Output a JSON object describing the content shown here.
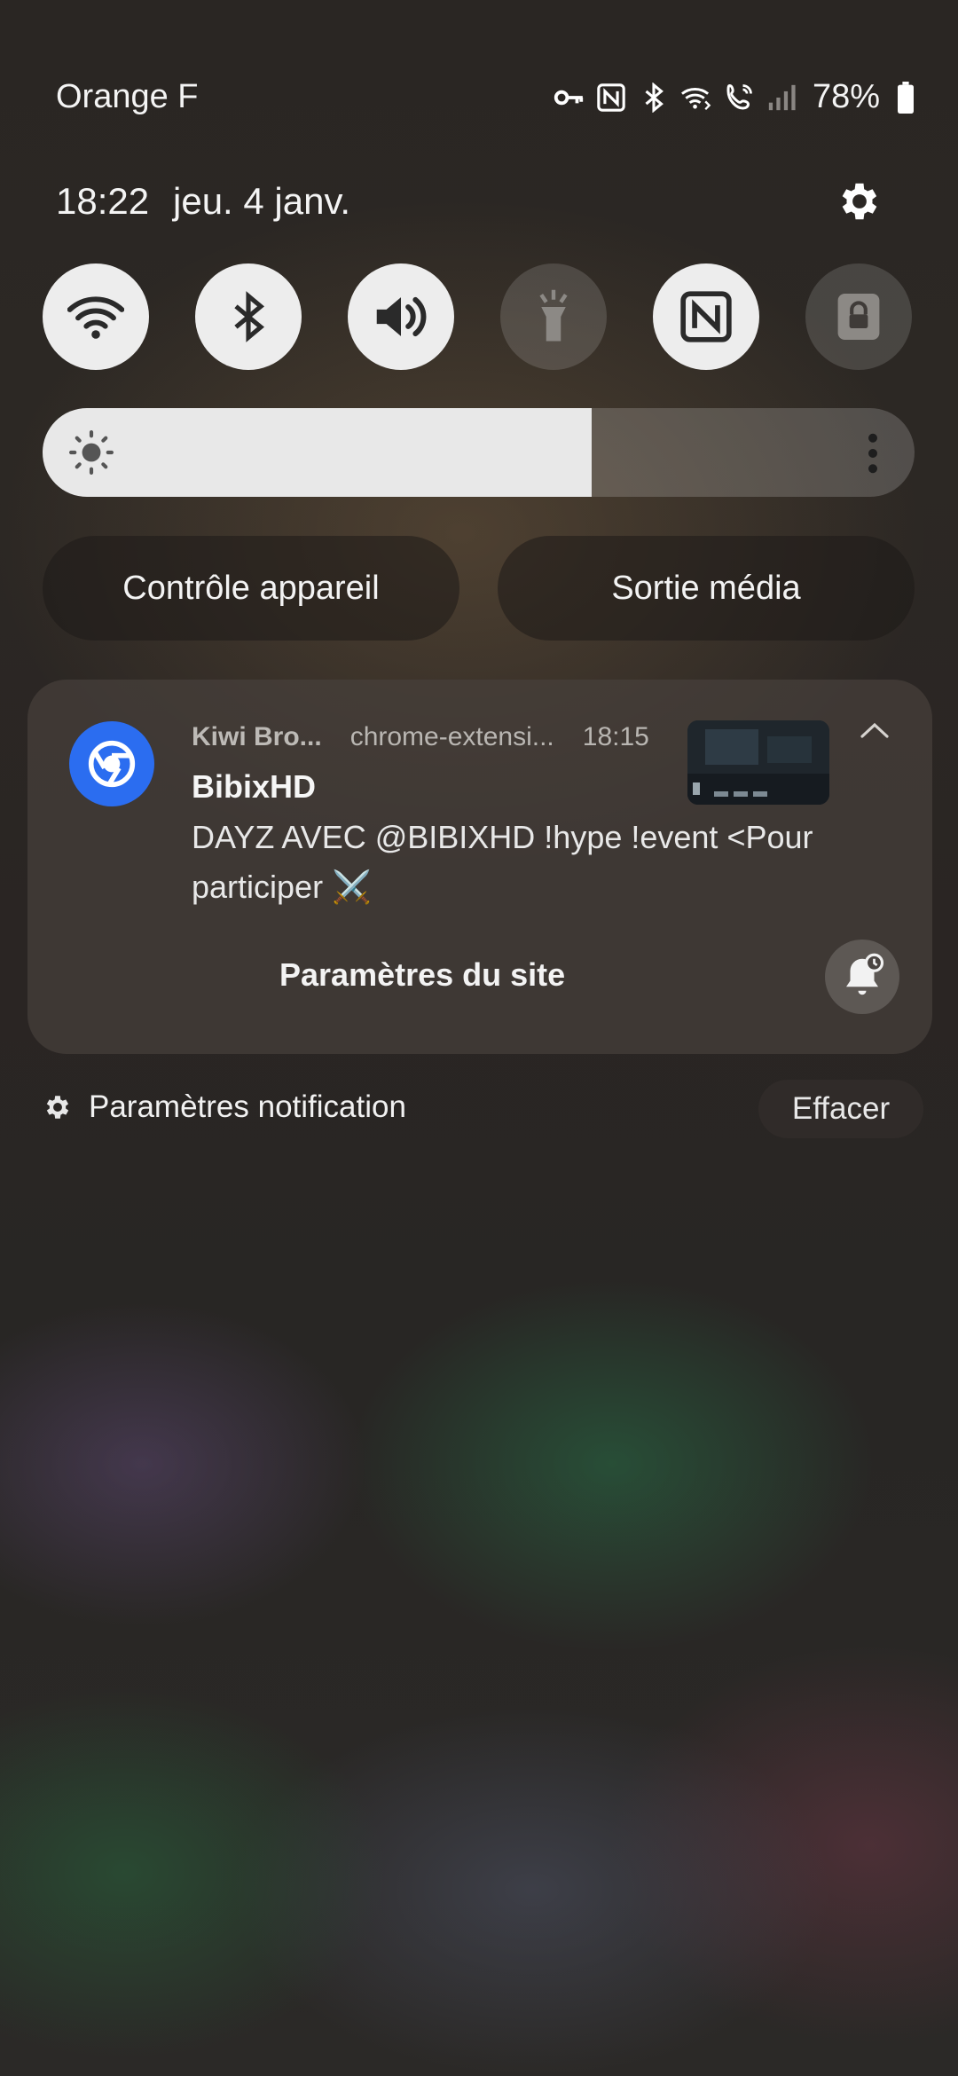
{
  "status_bar": {
    "carrier": "Orange F",
    "battery": "78%",
    "icons": [
      "vpn-key-icon",
      "nfc-icon",
      "bluetooth-icon",
      "wifi-calling-icon",
      "volte-call-icon",
      "signal-icon",
      "battery-icon"
    ]
  },
  "header": {
    "time": "18:22",
    "date": "jeu. 4 janv."
  },
  "quick_toggles": [
    {
      "name": "wifi",
      "icon": "wifi-icon",
      "on": true
    },
    {
      "name": "bluetooth",
      "icon": "bluetooth-icon",
      "on": true
    },
    {
      "name": "sound",
      "icon": "speaker-icon",
      "on": true
    },
    {
      "name": "flashlight",
      "icon": "flashlight-icon",
      "on": false
    },
    {
      "name": "nfc",
      "icon": "nfc-icon",
      "on": true
    },
    {
      "name": "secure-folder",
      "icon": "lock-icon",
      "on": false
    }
  ],
  "brightness": {
    "level": 0.63
  },
  "pills": {
    "device_control": "Contrôle appareil",
    "media_output": "Sortie média"
  },
  "notification": {
    "app": "Kiwi Bro...",
    "source": "chrome-extensi...",
    "time": "18:15",
    "title": "BibixHD",
    "body": "DAYZ AVEC @BIBIXHD !hype !event <Pour participer ⚔️",
    "action": "Paramètres du site"
  },
  "footer": {
    "notification_settings": "Paramètres notification",
    "clear": "Effacer"
  },
  "colors": {
    "toggle_on": "#ededed",
    "toggle_off": "#4a4542",
    "chrome_blue": "#2b6df0"
  }
}
